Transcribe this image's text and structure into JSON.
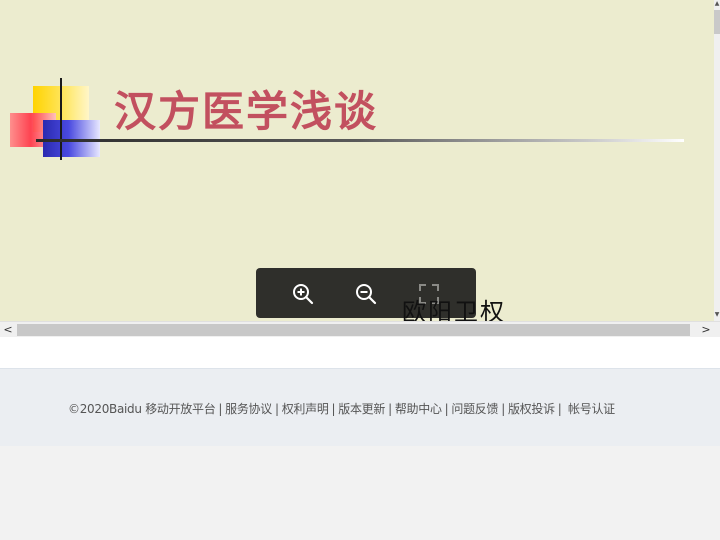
{
  "slide": {
    "title": "汉方医学浅谈",
    "watermark": "欧阳卫权",
    "colors": {
      "background": "#ececcf",
      "title": "#c2505f"
    }
  },
  "zoom_toolbar": {
    "buttons": [
      {
        "name": "zoom-in-button",
        "icon": "zoom-in-icon"
      },
      {
        "name": "zoom-out-button",
        "icon": "zoom-out-icon"
      },
      {
        "name": "fullscreen-button",
        "icon": "fullscreen-icon"
      }
    ]
  },
  "scrollbars": {
    "vertical": {
      "up": "▲",
      "down": "▼"
    },
    "horizontal": {
      "left": "<",
      "right": ">"
    }
  },
  "footer": {
    "copyright": "©2020Baidu",
    "links": [
      "移动开放平台",
      "服务协议",
      "权利声明",
      "版本更新",
      "帮助中心",
      "问题反馈",
      "版权投诉",
      "帐号认证"
    ],
    "separator": "|"
  }
}
